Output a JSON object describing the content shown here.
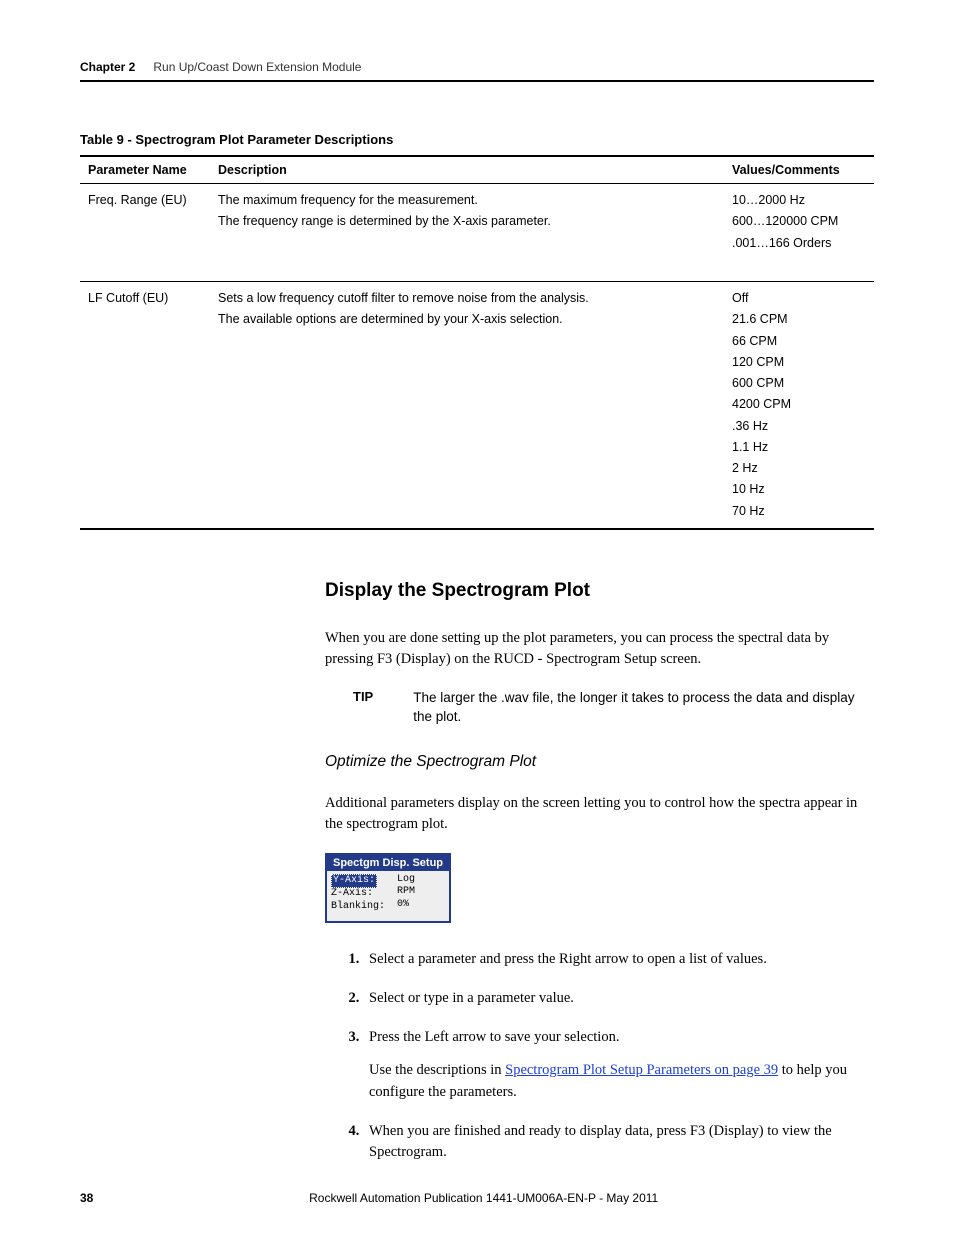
{
  "header": {
    "chapter_label": "Chapter 2",
    "chapter_title": "Run Up/Coast Down Extension Module"
  },
  "table": {
    "caption": "Table 9 - Spectrogram Plot Parameter Descriptions",
    "headers": {
      "name": "Parameter Name",
      "desc": "Description",
      "vals": "Values/Comments"
    },
    "rows": [
      {
        "name": "Freq. Range (EU)",
        "desc": [
          "The maximum frequency for the measurement.",
          "The frequency range is determined by the X-axis parameter."
        ],
        "vals": [
          "10…2000 Hz",
          "600…120000 CPM",
          ".001…166 Orders"
        ]
      },
      {
        "name": "LF Cutoff (EU)",
        "desc": [
          "Sets a low frequency cutoff filter to remove noise from the analysis.",
          "The available options are determined by your X-axis selection."
        ],
        "vals": [
          "Off",
          "21.6 CPM",
          "66 CPM",
          "120 CPM",
          "600 CPM",
          "4200 CPM",
          ".36 Hz",
          "1.1 Hz",
          "2 Hz",
          "10 Hz",
          "70 Hz"
        ]
      }
    ]
  },
  "section": {
    "heading": "Display the Spectrogram Plot",
    "intro": "When you are done setting up the plot parameters, you can process the spectral data by pressing F3 (Display) on the RUCD - Spectrogram Setup screen.",
    "tip_label": "TIP",
    "tip_text": "The larger the .wav file, the longer it takes to process the data and display the plot.",
    "sub_heading": "Optimize the Spectrogram Plot",
    "sub_intro": "Additional parameters display on the screen letting you to control how the spectra appear in the spectrogram plot."
  },
  "screenshot": {
    "title": "Spectgm Disp. Setup",
    "rows": [
      {
        "label": "Y-Axis:",
        "value": "Log",
        "selected": true
      },
      {
        "label": "Z-Axis:",
        "value": "RPM",
        "selected": false
      },
      {
        "label": "Blanking:",
        "value": "0%",
        "selected": false
      }
    ]
  },
  "steps": {
    "s1": "Select a parameter and press the Right arrow to open a list of values.",
    "s2": "Select or type in a parameter value.",
    "s3": "Press the Left arrow to save your selection.",
    "s3_sub_pre": "Use the descriptions in ",
    "s3_link": "Spectrogram Plot Setup Parameters on page 39",
    "s3_sub_post": " to help you configure the parameters.",
    "s4": "When you are finished and ready to display data, press F3 (Display) to view the Spectrogram."
  },
  "footer": {
    "page": "38",
    "pub": "Rockwell Automation Publication 1441-UM006A-EN-P - May 2011"
  }
}
